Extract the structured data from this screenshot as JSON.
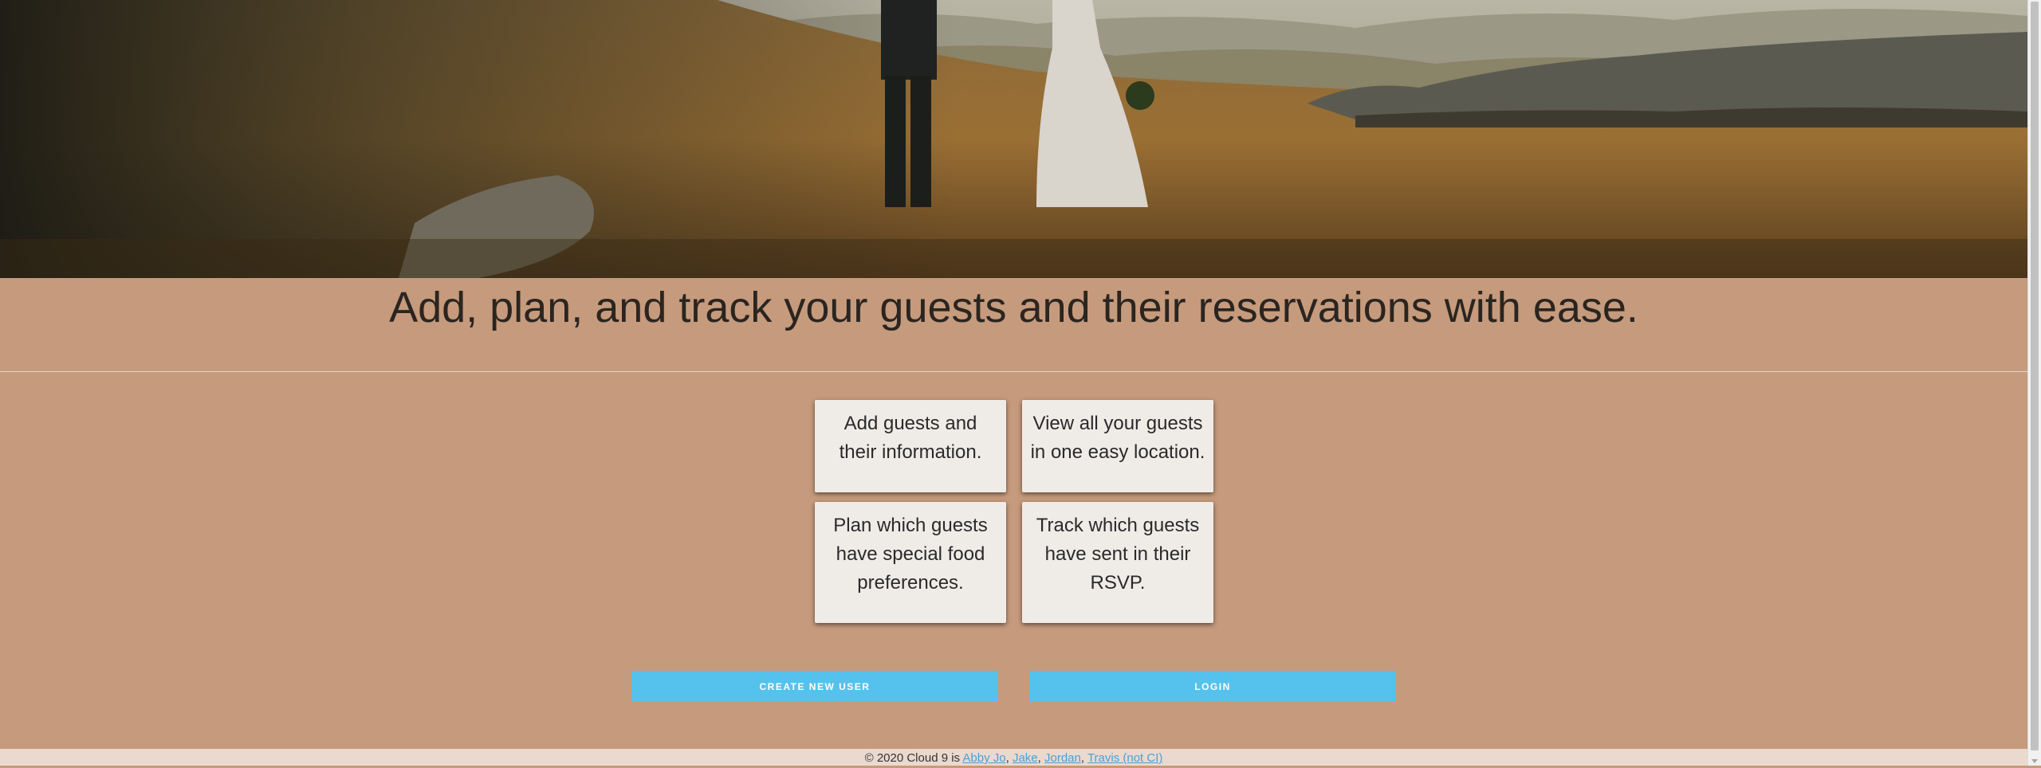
{
  "hero": {
    "image_description_icon": "wedding-couple-hero-photo-icon"
  },
  "headline": "Add, plan, and track your guests and their reservations with ease.",
  "features": [
    "Add guests and their information.",
    "View all your guests in one easy location.",
    "Plan which guests have special food preferences.",
    "Track which guests have sent in their RSVP."
  ],
  "buttons": {
    "create_user": "CREATE NEW USER",
    "login": "LOGIN"
  },
  "footer": {
    "prefix": "© 2020 Cloud 9 is ",
    "links": [
      "Abby Jo",
      "Jake",
      "Jordan",
      "Travis (not CI)"
    ],
    "separator": ", "
  },
  "colors": {
    "background": "#c69a7c",
    "button": "#55c2ee",
    "card": "#efece8",
    "footer": "#ead9ce",
    "link": "#4a9fd6"
  }
}
